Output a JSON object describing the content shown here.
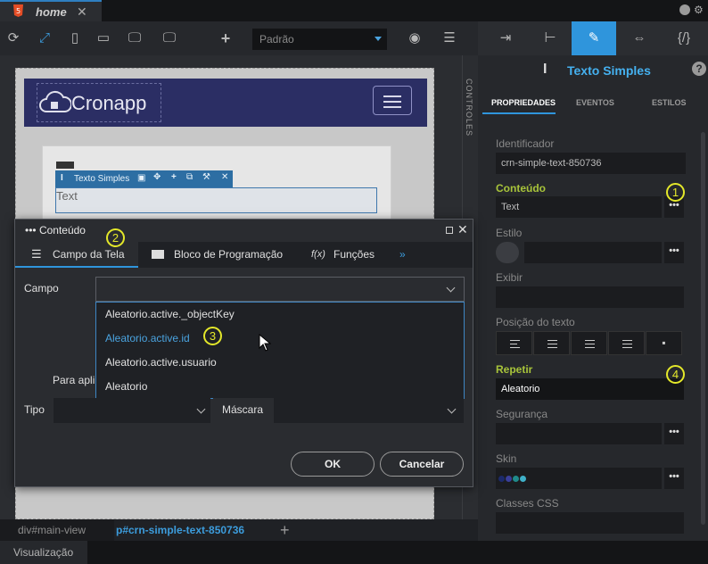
{
  "tab": {
    "label": "home",
    "close": "✕"
  },
  "toolbar": {
    "preset": "Padrão"
  },
  "canvas": {
    "logo": "Cronapp",
    "component_toolbar_label": "Texto Simples",
    "component_text": "Text",
    "controles": "CONTROLES"
  },
  "breadcrumb": {
    "item1": "div#main-view",
    "item2": "p#crn-simple-text-850736"
  },
  "status": {
    "label": "Visualização"
  },
  "panel": {
    "title": "Texto Simples",
    "help": "?",
    "tabs": [
      "PROPRIEDADES",
      "EVENTOS",
      "ESTILOS"
    ],
    "identificador_label": "Identificador",
    "identificador_value": "crn-simple-text-850736",
    "conteudo_label": "Conteúdo",
    "conteudo_value": "Text",
    "estilo_label": "Estilo",
    "exibir_label": "Exibir",
    "posicao_label": "Posição do texto",
    "repetir_label": "Repetir",
    "repetir_value": "Aleatorio",
    "seguranca_label": "Segurança",
    "skin_label": "Skin",
    "classes_label": "Classes CSS",
    "more": "•••",
    "badges": [
      "1",
      "4"
    ]
  },
  "dialog": {
    "title": "Conteúdo",
    "tabs": [
      "Campo da Tela",
      "Bloco de Programação",
      "Funções"
    ],
    "more_tabs": "»",
    "campo_label": "Campo",
    "options": [
      "Aleatorio.active._objectKey",
      "Aleatorio.active.id",
      "Aleatorio.active.usuario",
      "Aleatorio"
    ],
    "para_label": "Para apli",
    "tipo_label": "Tipo",
    "mascara_label": "Máscara",
    "ok": "OK",
    "cancel": "Cancelar",
    "badges": [
      "2",
      "3"
    ]
  }
}
